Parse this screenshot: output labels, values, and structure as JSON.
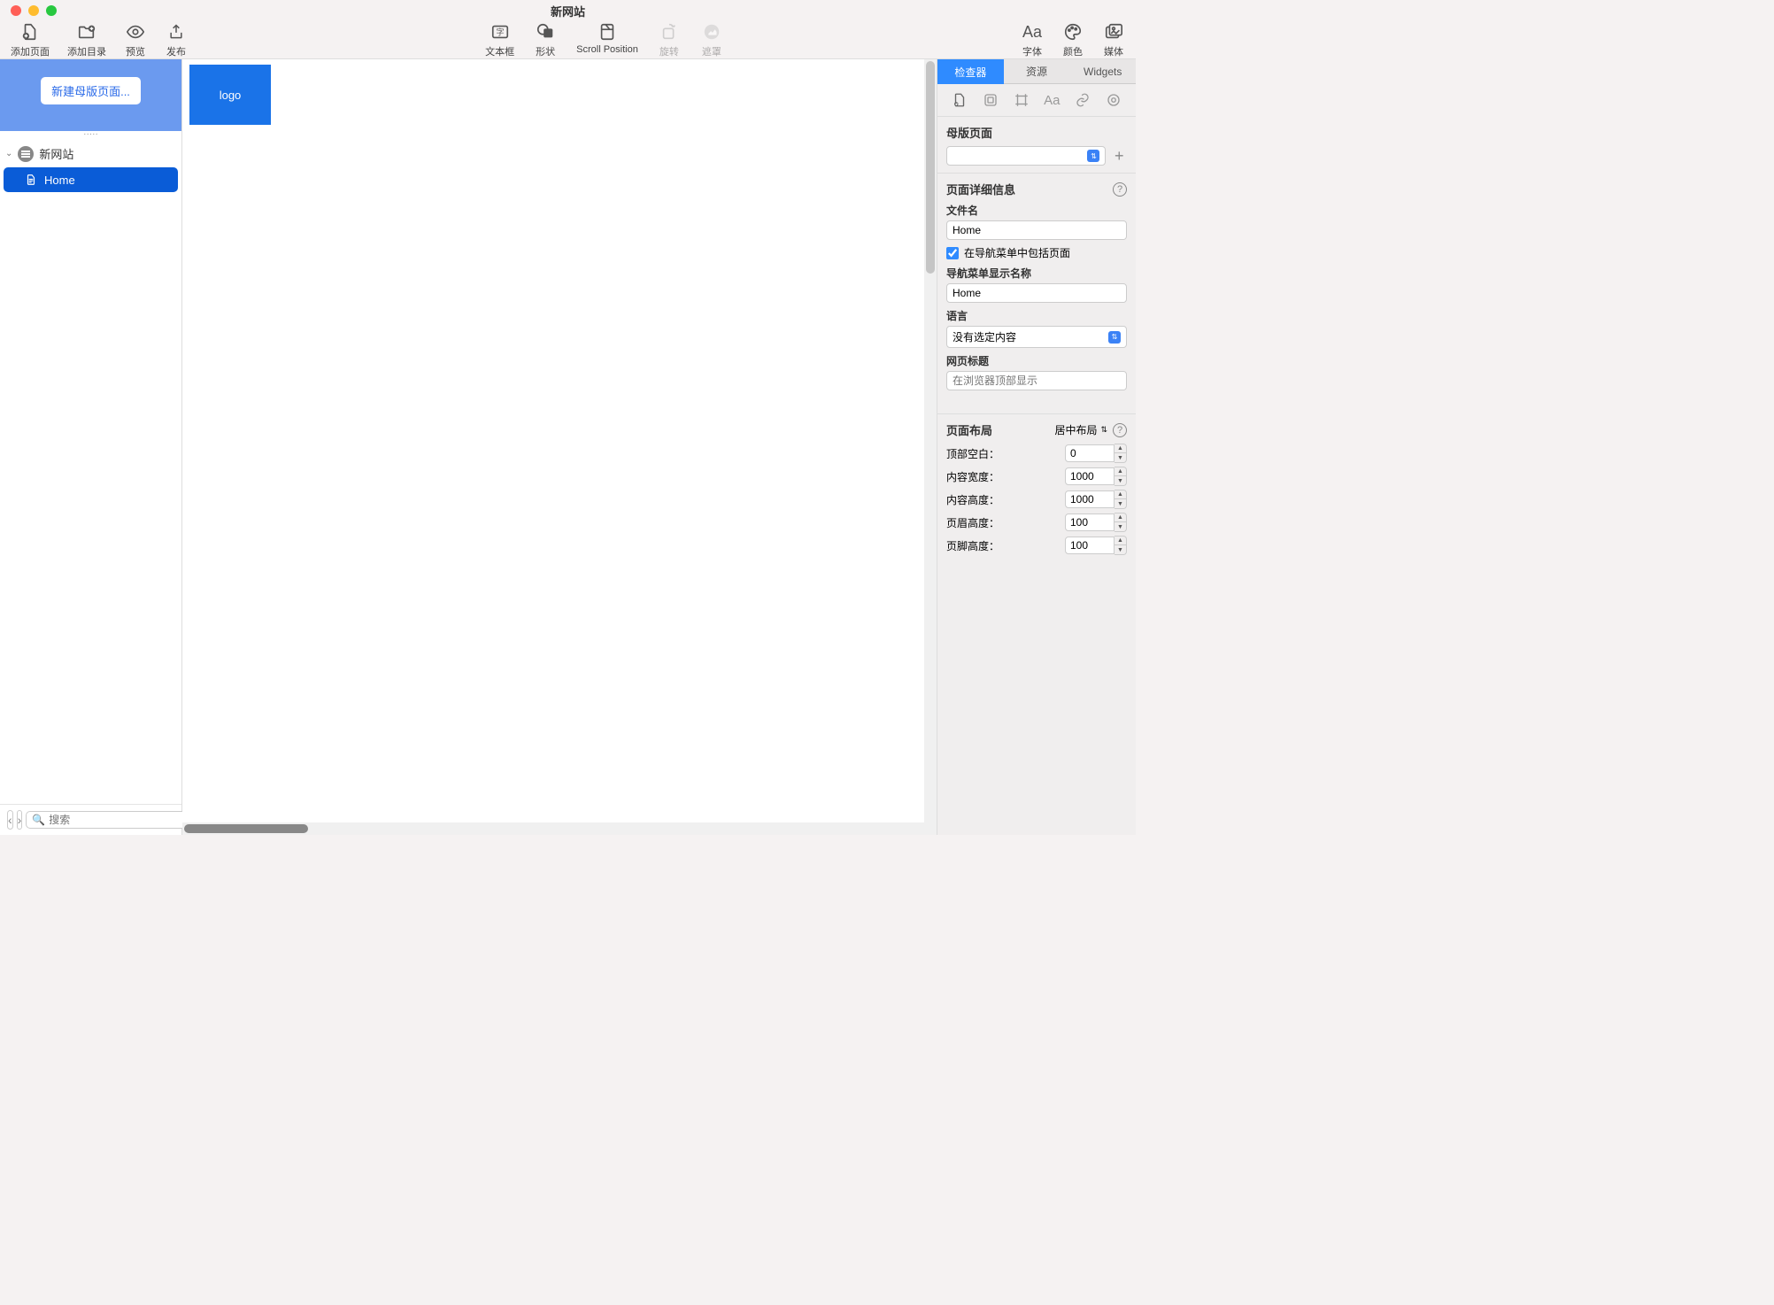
{
  "window": {
    "title": "新网站"
  },
  "toolbar": {
    "left": [
      {
        "label": "添加页面",
        "name": "add-page-button"
      },
      {
        "label": "添加目录",
        "name": "add-folder-button"
      },
      {
        "label": "预览",
        "name": "preview-button"
      },
      {
        "label": "发布",
        "name": "publish-button"
      }
    ],
    "center": [
      {
        "label": "文本框",
        "name": "textbox-button"
      },
      {
        "label": "形状",
        "name": "shape-button"
      },
      {
        "label": "Scroll Position",
        "name": "scroll-position-button"
      },
      {
        "label": "旋转",
        "name": "rotate-button",
        "disabled": true
      },
      {
        "label": "遮罩",
        "name": "mask-button",
        "disabled": true
      }
    ],
    "right": [
      {
        "label": "字体",
        "name": "fonts-button"
      },
      {
        "label": "颜色",
        "name": "colors-button"
      },
      {
        "label": "媒体",
        "name": "media-button"
      }
    ]
  },
  "sidebar": {
    "master_btn": "新建母版页面...",
    "root": "新网站",
    "pages": [
      {
        "label": "Home"
      }
    ],
    "search_placeholder": "搜索"
  },
  "canvas": {
    "logo_text": "logo"
  },
  "inspector": {
    "tabs": [
      "检查器",
      "资源",
      "Widgets"
    ],
    "master_section": {
      "title": "母版页面",
      "value": ""
    },
    "details": {
      "title": "页面详细信息",
      "filename_label": "文件名",
      "filename": "Home",
      "include_nav_label": "在导航菜单中包括页面",
      "include_nav_checked": true,
      "nav_name_label": "导航菜单显示名称",
      "nav_name": "Home",
      "language_label": "语言",
      "language_value": "没有选定内容",
      "page_title_label": "网页标题",
      "page_title_placeholder": "在浏览器顶部显示"
    },
    "layout": {
      "title": "页面布局",
      "mode": "居中布局",
      "rows": [
        {
          "label": "顶部空白：",
          "value": "0"
        },
        {
          "label": "内容宽度：",
          "value": "1000"
        },
        {
          "label": "内容高度：",
          "value": "1000"
        },
        {
          "label": "页眉高度：",
          "value": "100"
        },
        {
          "label": "页脚高度：",
          "value": "100"
        }
      ]
    }
  }
}
